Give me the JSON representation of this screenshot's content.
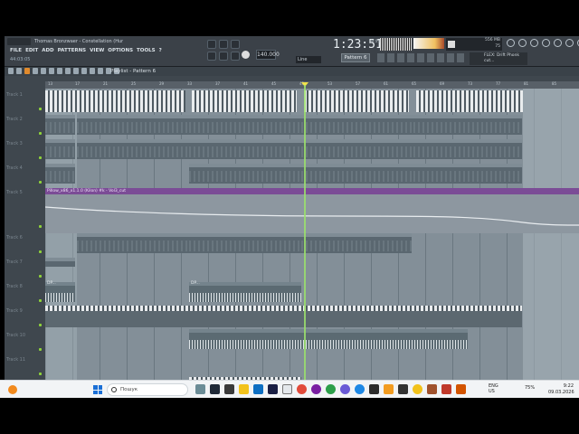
{
  "app": {
    "song_title": "Thomas Bronzwaer - Constellation (Hunter...",
    "menu": [
      "FILE",
      "EDIT",
      "ADD",
      "PATTERNS",
      "VIEW",
      "OPTIONS",
      "TOOLS",
      "?"
    ],
    "small_time": "44:03:05",
    "tempo": "140.000",
    "time_display": "1:23:51",
    "time_sub": "M:S:CS",
    "cpu_mem": "556 MB",
    "cpu_sub": "75",
    "pattern_selector": "Pattern 6",
    "line_selector": "Line",
    "hint": "FLEX: Drift Phonk cut...",
    "hint_label": "hint-text"
  },
  "playlist": {
    "title": "Playlist - Pattern 6",
    "timeline_marks": [
      "13",
      "17",
      "21",
      "25",
      "29",
      "33",
      "37",
      "41",
      "45",
      "49",
      "53",
      "57",
      "61",
      "65",
      "69",
      "73",
      "77",
      "81",
      "85"
    ],
    "tracks": [
      "Track 1",
      "Track 2",
      "Track 3",
      "Track 4",
      "Track 5",
      "Track 6",
      "Track 7",
      "Track 8",
      "Track 9",
      "Track 10",
      "Track 11"
    ],
    "clips": {
      "pattern2": [
        "Pattern 2",
        "Pattern 2",
        "Pattern 2",
        "Pattern 2",
        "Pattern 2"
      ],
      "pattern3": [
        "Pattern 3",
        "Pattern 3",
        "Pattern 3",
        "Pattern 3",
        "Pattern 3"
      ],
      "pattern5": [
        "Pattern 5",
        "Pattern 5",
        "Pattern 5",
        "Pattern 5"
      ],
      "pattern6": [
        "Pattern 6",
        "Pattern 6",
        "Pattern 6"
      ],
      "audio_name": "Pillow_x86_x1.1.0 (Kilon) #k - Vol3_cut",
      "dp": "DP..."
    }
  },
  "taskbar": {
    "search_placeholder": "Пошук",
    "lang_top": "ENG",
    "lang_bottom": "US",
    "battery": "75%",
    "time": "9:22",
    "date": "09.03.2026"
  },
  "colors": {
    "accent_purple": "#7b4c96",
    "playhead": "#9be06c",
    "windows_blue": "#1a6fd6"
  }
}
